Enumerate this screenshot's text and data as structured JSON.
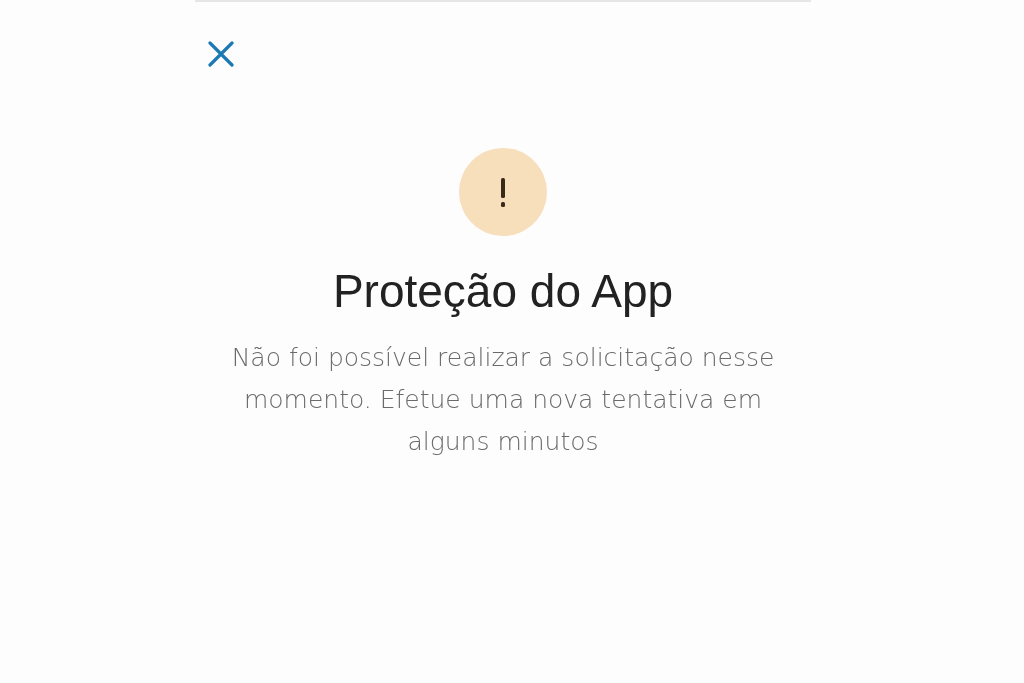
{
  "dialog": {
    "title": "Proteção do App",
    "message": "Não foi possível realizar a solicitação nesse momento. Efetue uma nova tentativa em alguns minutos"
  }
}
